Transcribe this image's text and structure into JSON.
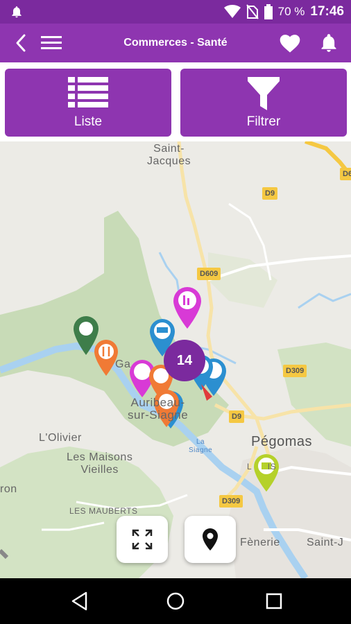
{
  "status_bar": {
    "battery": "70 %",
    "time": "17:46",
    "icons": [
      "notification-bell-icon",
      "wifi-icon",
      "no-sim-icon",
      "battery-icon"
    ]
  },
  "app_bar": {
    "title": "Commerces - Santé",
    "icons": [
      "back-arrow-icon",
      "menu-icon",
      "favorite-heart-icon",
      "notification-bell-icon"
    ]
  },
  "toolbar": {
    "list_label": "Liste",
    "filter_label": "Filtrer"
  },
  "map": {
    "places": {
      "saint_jacques": "Saint-\nJacques",
      "galardier": "Ga",
      "auribeau": "Auribeau-\nsur-Siagne",
      "lolivier": "L'Olivier",
      "maisons_vieilles": "Les Maisons\nVieilles",
      "les_mauberts": "LES MAUBERTS",
      "ron": "ron",
      "pegomas": "Pégomas",
      "fenerie": "Fènerie",
      "saint_j": "Saint-J",
      "la_siagne": "La\nSiagne",
      "lou_lis": "L      IS"
    },
    "roads": {
      "d9_top": "D9",
      "d609": "D609",
      "d309": "D309",
      "d9_mid": "D9",
      "d309_low": "D309",
      "d6_right": "D6"
    },
    "cluster_count": "14",
    "controls": [
      "fullscreen-icon",
      "my-location-icon"
    ]
  },
  "colors": {
    "purple": "#8e35b0",
    "purple_dark": "#7b2a9e",
    "pin_magenta": "#d83ad6",
    "pin_blue": "#2b8fd0",
    "pin_orange": "#f07a35",
    "pin_green": "#3e7d4a",
    "pin_yellow_green": "#b5d12a"
  }
}
